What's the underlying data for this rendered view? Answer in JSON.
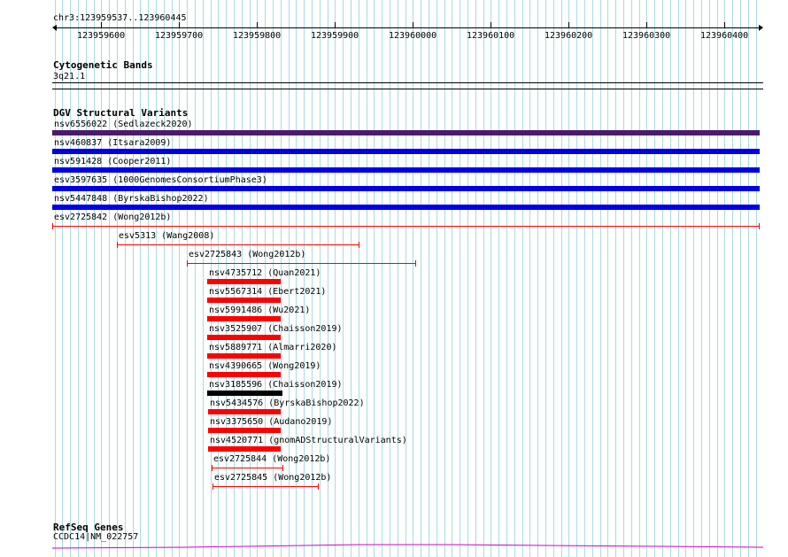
{
  "ruler": {
    "region": "chr3:123959537..123960445",
    "ticks": [
      "123959600",
      "123959700",
      "123959800",
      "123959900",
      "123960000",
      "123960100",
      "123960200",
      "123960300",
      "123960400"
    ]
  },
  "cytobands": {
    "title": "Cytogenetic Bands",
    "band": "3q21.1"
  },
  "dgv": {
    "title": "DGV Structural Variants",
    "colors": {
      "purple": "#4a1a6e",
      "blue": "#0000e6",
      "red": "#ff0000",
      "black": "#000000"
    },
    "items": [
      {
        "label": "nsv6556022 (Sedlazeck2020)",
        "color": "purple",
        "style": "thick",
        "start": 123959537,
        "end": 123960445
      },
      {
        "label": "nsv460837 (Itsara2009)",
        "color": "blue",
        "style": "thick",
        "start": 123959537,
        "end": 123960445
      },
      {
        "label": "nsv591428 (Cooper2011)",
        "color": "blue",
        "style": "thick",
        "start": 123959537,
        "end": 123960445
      },
      {
        "label": "esv3597635 (1000GenomesConsortiumPhase3)",
        "color": "blue",
        "style": "thick",
        "start": 123959537,
        "end": 123960445
      },
      {
        "label": "nsv5447848 (ByrskaBishop2022)",
        "color": "blue",
        "style": "thick",
        "start": 123959537,
        "end": 123960445
      },
      {
        "label": "esv2725842 (Wong2012b)",
        "color": "red",
        "style": "thin",
        "start": 123959537,
        "end": 123960444
      },
      {
        "label": "esv5313 (Wang2008)",
        "color": "red",
        "style": "thin",
        "start": 123959620,
        "end": 123959930
      },
      {
        "label": "esv2725843 (Wong2012b)",
        "color": "red",
        "style": "thin",
        "start": 123959710,
        "end": 123960003
      },
      {
        "label": "nsv4735712 (Quan2021)",
        "color": "red",
        "style": "thick",
        "start": 123959736,
        "end": 123959830
      },
      {
        "label": "nsv5567314 (Ebert2021)",
        "color": "red",
        "style": "thick",
        "start": 123959736,
        "end": 123959830
      },
      {
        "label": "nsv5991486 (Wu2021)",
        "color": "red",
        "style": "thick",
        "start": 123959736,
        "end": 123959830
      },
      {
        "label": "nsv3525907 (Chaisson2019)",
        "color": "red",
        "style": "thick",
        "start": 123959736,
        "end": 123959830
      },
      {
        "label": "nsv5889771 (Almarri2020)",
        "color": "red",
        "style": "thick",
        "start": 123959736,
        "end": 123959830
      },
      {
        "label": "nsv4390665 (Wong2019)",
        "color": "red",
        "style": "thick",
        "start": 123959736,
        "end": 123959830
      },
      {
        "label": "nsv3185596 (Chaisson2019)",
        "color": "black",
        "style": "thick",
        "start": 123959736,
        "end": 123959832
      },
      {
        "label": "nsv5434576 (ByrskaBishop2022)",
        "color": "red",
        "style": "thick",
        "start": 123959737,
        "end": 123959830
      },
      {
        "label": "nsv3375650 (Audano2019)",
        "color": "red",
        "style": "thick",
        "start": 123959737,
        "end": 123959830
      },
      {
        "label": "nsv4520771 (gnomADStructuralVariants)",
        "color": "red",
        "style": "thick",
        "start": 123959737,
        "end": 123959830
      },
      {
        "label": "esv2725844 (Wong2012b)",
        "color": "red",
        "style": "thin",
        "start": 123959741,
        "end": 123959833
      },
      {
        "label": "esv2725845 (Wong2012b)",
        "color": "red",
        "style": "thin",
        "start": 123959743,
        "end": 123959878
      }
    ]
  },
  "refseq": {
    "title": "RefSeq Genes",
    "gene": "CCDC14|NM_022757",
    "color": "#cc00cc"
  }
}
